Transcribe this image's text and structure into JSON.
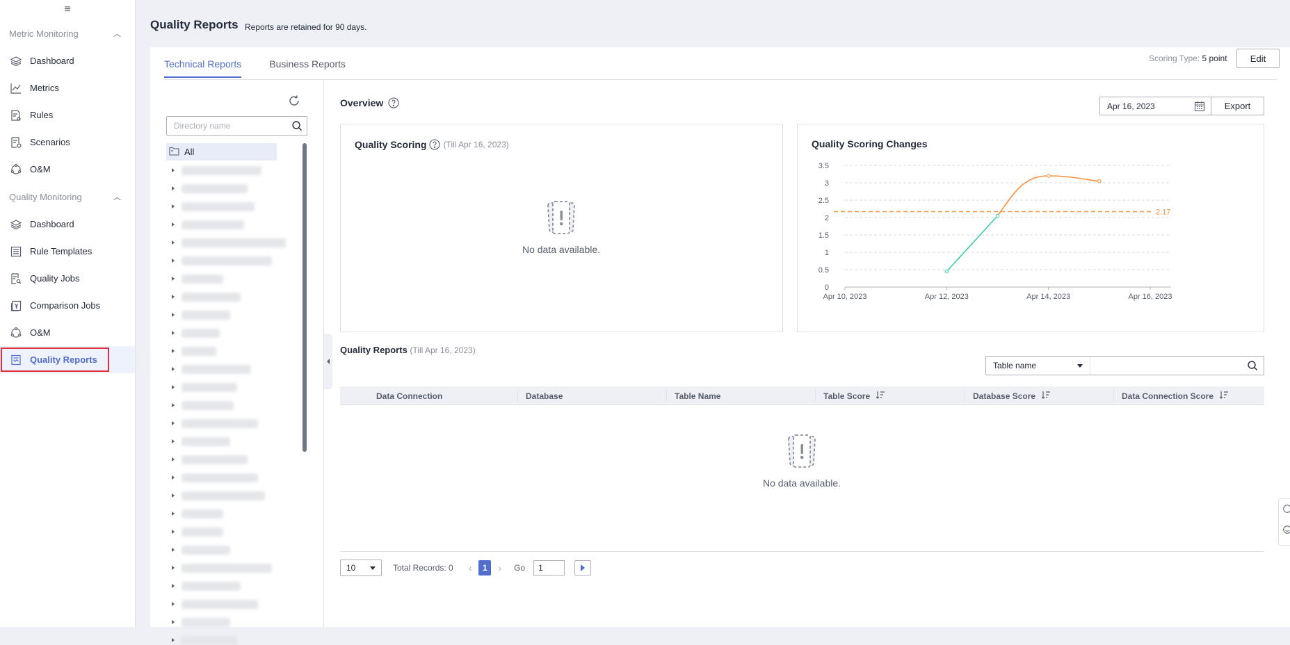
{
  "sidebar": {
    "groups": [
      {
        "title": "Metric Monitoring",
        "items": [
          "Dashboard",
          "Metrics",
          "Rules",
          "Scenarios",
          "O&M"
        ]
      },
      {
        "title": "Quality Monitoring",
        "items": [
          "Dashboard",
          "Rule Templates",
          "Quality Jobs",
          "Comparison Jobs",
          "O&M",
          "Quality Reports"
        ]
      }
    ]
  },
  "page": {
    "title": "Quality Reports",
    "subtitle": "Reports are retained for 90 days."
  },
  "tabs": [
    "Technical Reports",
    "Business Reports"
  ],
  "scoring": {
    "label": "Scoring Type:",
    "value": "5 point",
    "edit": "Edit"
  },
  "tree": {
    "search_placeholder": "Directory name",
    "root": "All"
  },
  "overview": {
    "title": "Overview",
    "date": "Apr 16, 2023",
    "export": "Export",
    "quality_scoring": {
      "title": "Quality Scoring",
      "till": "(Till Apr 16, 2023)",
      "empty": "No data available."
    },
    "changes_title": "Quality Scoring Changes"
  },
  "chart_data": {
    "type": "line",
    "title": "Quality Scoring Changes",
    "x_ticks": [
      "Apr 10, 2023",
      "Apr 12, 2023",
      "Apr 14, 2023",
      "Apr 16, 2023"
    ],
    "y_ticks": [
      "0",
      "0.5",
      "1",
      "1.5",
      "2",
      "2.5",
      "3",
      "3.5"
    ],
    "ylim": [
      0,
      3.5
    ],
    "xlim": [
      "Apr 10, 2023",
      "Apr 16, 2023"
    ],
    "series": [
      {
        "x": [
          "Apr 12, 2023",
          "Apr 13, 2023",
          "Apr 14, 2023",
          "Apr 15, 2023"
        ],
        "values": [
          0.45,
          2.05,
          3.2,
          3.05
        ],
        "color_low": "#3dcca6",
        "color_high": "#f7913b"
      }
    ],
    "reference_line": {
      "value": 2.17,
      "label": "2.17",
      "color": "#f7913b"
    },
    "grid": true
  },
  "reports": {
    "title": "Quality Reports",
    "till": "(Till Apr 16, 2023)",
    "filter_select": "Table name",
    "columns": [
      "Data Connection",
      "Database",
      "Table Name",
      "Table Score",
      "Database Score",
      "Data Connection Score"
    ],
    "empty": "No data available."
  },
  "pager": {
    "page_size": "10",
    "total": "Total Records: 0",
    "current": "1",
    "go_label": "Go",
    "go_value": "1"
  },
  "colors": {
    "accent": "#526ecc",
    "highlight": "#e0303f"
  }
}
